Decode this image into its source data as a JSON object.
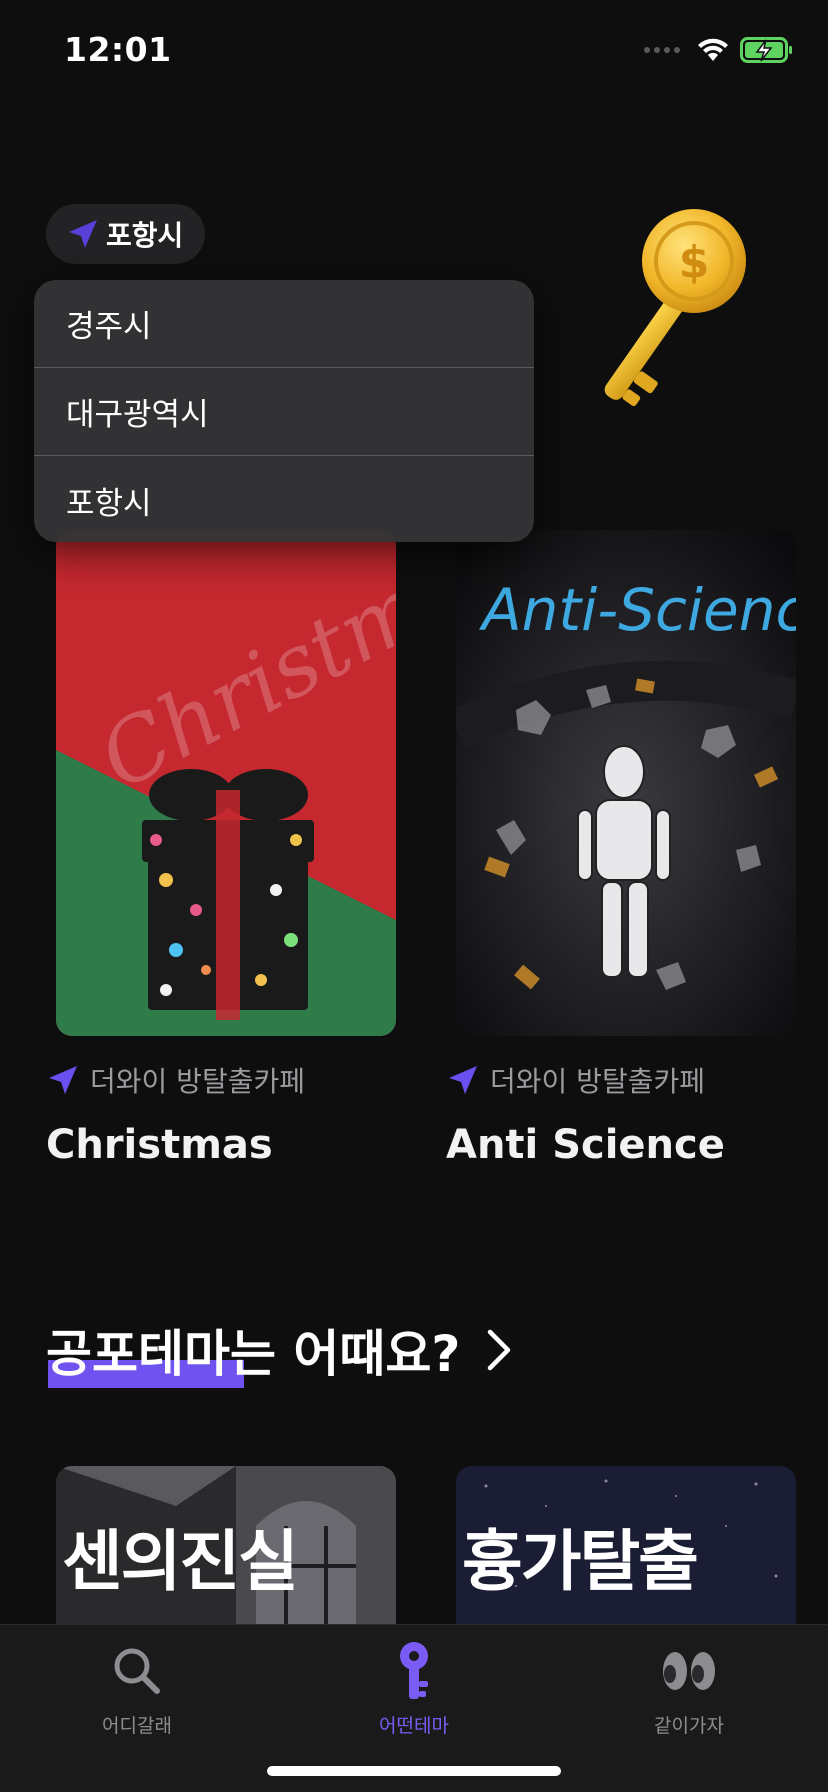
{
  "status_bar": {
    "time": "12:01"
  },
  "location": {
    "current": "포항시"
  },
  "dropdown": {
    "items": [
      {
        "label": "경주시"
      },
      {
        "label": "대구광역시"
      },
      {
        "label": "포항시"
      }
    ]
  },
  "cards": [
    {
      "poster_text": "Christmas",
      "cafe": "더와이 방탈출카페",
      "title": "Christmas"
    },
    {
      "poster_text": "Anti-Science",
      "cafe": "더와이 방탈출카페",
      "title": "Anti Science"
    }
  ],
  "section": {
    "title": "공포테마는 어때요?"
  },
  "row2_posters": [
    {
      "caption": "센의진실"
    },
    {
      "caption": "흉가탈출"
    }
  ],
  "tabs": [
    {
      "label": "어디갈래",
      "icon": "search-icon"
    },
    {
      "label": "어떤테마",
      "icon": "key-icon"
    },
    {
      "label": "같이가자",
      "icon": "eyes-icon"
    }
  ],
  "colors": {
    "accent": "#6f52f0",
    "background": "#0e0e0f",
    "tab_active": "#7a5cf5"
  }
}
